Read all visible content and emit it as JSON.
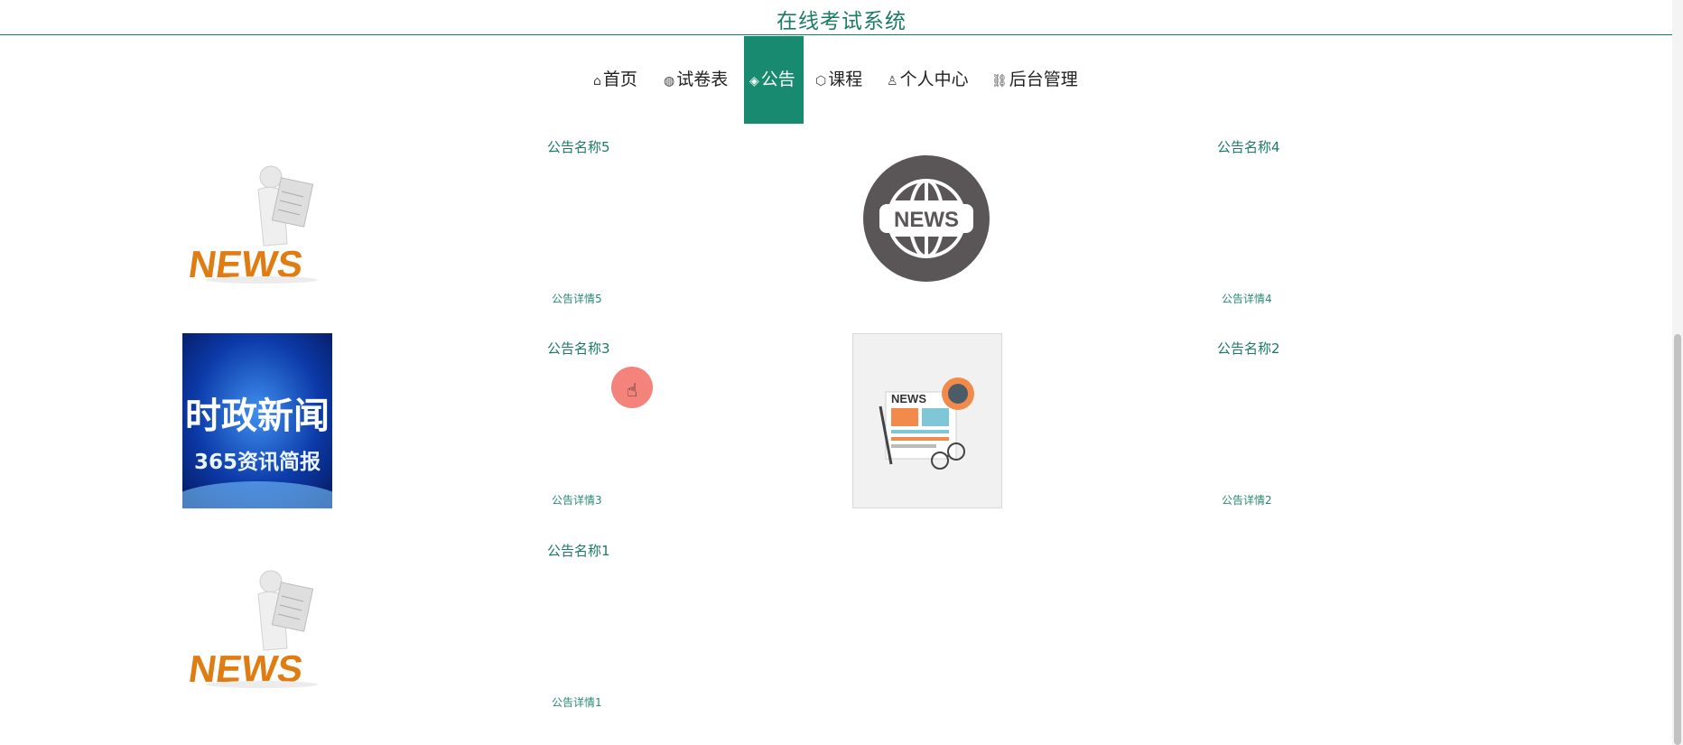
{
  "app": {
    "title": "在线考试系统"
  },
  "nav": {
    "items": [
      {
        "label": "首页",
        "icon": "home-icon",
        "active": false
      },
      {
        "label": "试卷表",
        "icon": "globe-icon",
        "active": false
      },
      {
        "label": "公告",
        "icon": "layers-icon",
        "active": true
      },
      {
        "label": "课程",
        "icon": "cube-icon",
        "active": false
      },
      {
        "label": "个人中心",
        "icon": "user-icon",
        "active": false
      },
      {
        "label": "后台管理",
        "icon": "link-icon",
        "active": false
      }
    ]
  },
  "notices": [
    {
      "name": "公告名称5",
      "detail": "公告详情5",
      "image": "news-figure-orange"
    },
    {
      "name": "公告名称4",
      "detail": "公告详情4",
      "image": "news-globe-circle"
    },
    {
      "name": "公告名称3",
      "detail": "公告详情3",
      "image": "political-news-blue",
      "image_text": "时政新闻",
      "image_subtext": "365资讯简报"
    },
    {
      "name": "公告名称2",
      "detail": "公告详情2",
      "image": "newspaper-illustration",
      "image_text": "NEWS"
    },
    {
      "name": "公告名称1",
      "detail": "公告详情1",
      "image": "news-figure-orange"
    }
  ],
  "image_labels": {
    "news": "NEWS"
  },
  "colors": {
    "accent": "#178a70",
    "title": "#1c7b68"
  }
}
